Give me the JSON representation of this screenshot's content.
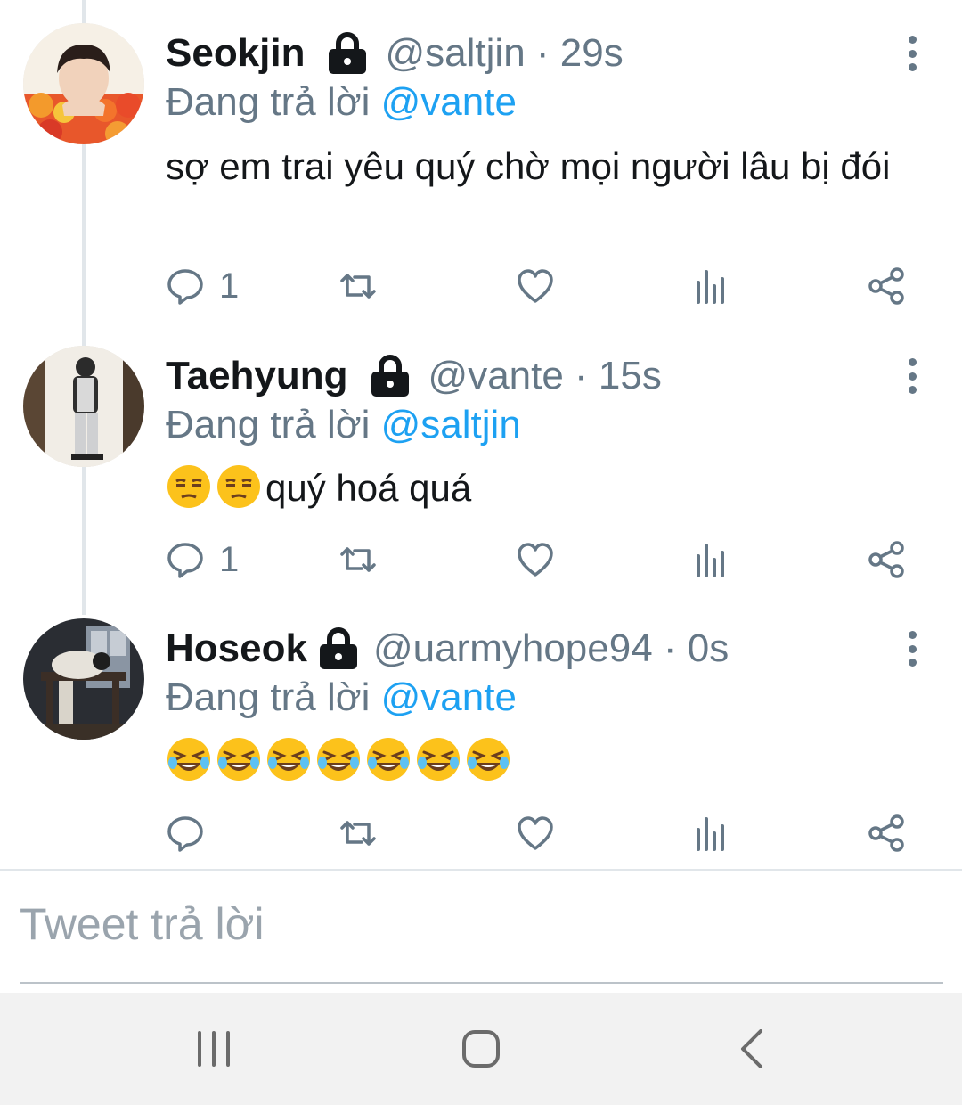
{
  "tweets": [
    {
      "name": "Seokjin",
      "handle_time": "@saltjin · 29s",
      "replying_prefix": "Đang trả lời ",
      "replying_to": "@vante",
      "text": "sợ em trai yêu quý chờ mọi người lâu bị đói",
      "emoji_icons": [],
      "reply_count": "1"
    },
    {
      "name": "Taehyung",
      "handle_time": "@vante · 15s",
      "replying_prefix": "Đang trả lời ",
      "replying_to": "@saltjin",
      "text": "quý hoá quá",
      "emoji_icons": [
        "unamused-face-icon",
        "unamused-face-icon"
      ],
      "reply_count": "1"
    },
    {
      "name": "Hoseok",
      "handle_time": "@uarmyhope94 · 0s",
      "replying_prefix": "Đang trả lời ",
      "replying_to": "@vante",
      "text": "",
      "emoji_icons": [
        "rolling-on-floor-laughing-icon",
        "rolling-on-floor-laughing-icon",
        "rolling-on-floor-laughing-icon",
        "rolling-on-floor-laughing-icon",
        "rolling-on-floor-laughing-icon",
        "rolling-on-floor-laughing-icon",
        "rolling-on-floor-laughing-icon"
      ],
      "reply_count": ""
    }
  ],
  "reply_input": {
    "placeholder": "Tweet trả lời"
  },
  "colors": {
    "accent": "#1da1f2",
    "secondary_text": "#657786",
    "primary_text": "#14171a",
    "navbar_bg": "#f2f2f2"
  },
  "navbar": {
    "buttons": [
      "recent-apps-icon",
      "home-icon",
      "back-icon"
    ]
  }
}
